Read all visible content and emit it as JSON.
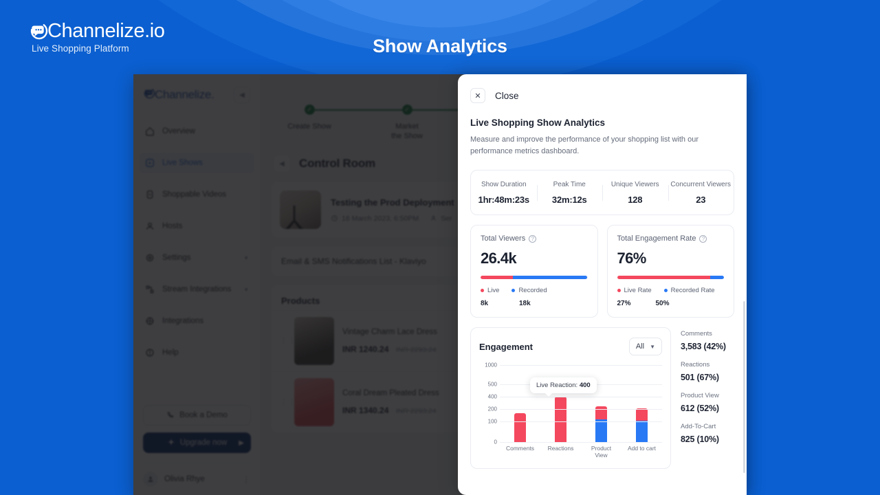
{
  "brand": {
    "name": "Channelize.io",
    "tagline": "Live Shopping Platform",
    "icon": "chat-bubble-icon"
  },
  "page_title": "Show Analytics",
  "app": {
    "sidebar": {
      "logo": "Channelize.",
      "collapse_icon": "chevron-left-icon",
      "items": [
        {
          "label": "Overview",
          "icon": "home-icon",
          "active": false,
          "expandable": false
        },
        {
          "label": "Live Shows",
          "icon": "play-circle-icon",
          "active": true,
          "expandable": false
        },
        {
          "label": "Shoppable Videos",
          "icon": "video-icon",
          "active": false,
          "expandable": false
        },
        {
          "label": "Hosts",
          "icon": "user-icon",
          "active": false,
          "expandable": false
        },
        {
          "label": "Settings",
          "icon": "gear-icon",
          "active": false,
          "expandable": true
        },
        {
          "label": "Stream Integrations",
          "icon": "stream-icon",
          "active": false,
          "expandable": true
        },
        {
          "label": "Integrations",
          "icon": "plug-icon",
          "active": false,
          "expandable": false
        },
        {
          "label": "Help",
          "icon": "help-icon",
          "active": false,
          "expandable": false
        }
      ],
      "demo_button": "Book a Demo",
      "demo_icon": "phone-icon",
      "upgrade_button": "Upgrade now",
      "upgrade_icon": "diamond-icon",
      "upgrade_arrow": "chevron-right-icon",
      "user_name": "Olivia Rhye",
      "user_menu_icon": "more-vertical-icon"
    },
    "stepper": [
      {
        "label": "Create Show",
        "done": true
      },
      {
        "label": "Market\nthe Show",
        "done": true
      }
    ],
    "control_room": {
      "back_icon": "chevron-left-icon",
      "title": "Control Room"
    },
    "show": {
      "title": "Testing the Prod Deployment",
      "date_icon": "clock-icon",
      "date": "18 March 2023, 6:50PM",
      "host_icon": "user-icon",
      "host": "Ser"
    },
    "notifications_row": "Email & SMS Notifications List - Klaviyo",
    "products": {
      "heading": "Products",
      "items": [
        {
          "name": "Vintage Charm Lace Dress",
          "price": "INR 1240.24",
          "compare_at": "INR 2293.24"
        },
        {
          "name": "Coral Dream Pleated Dress",
          "price": "INR 1340.24",
          "compare_at": "INR 2293.24"
        }
      ]
    }
  },
  "modal": {
    "close_icon": "close-icon",
    "close_label": "Close",
    "title": "Live Shopping Show Analytics",
    "subtitle": "Measure and improve the performance of your shopping list with our performance metrics dashboard.",
    "summary": [
      {
        "key": "Show Duration",
        "value": "1hr:48m:23s"
      },
      {
        "key": "Peak Time",
        "value": "32m:12s"
      },
      {
        "key": "Unique Viewers",
        "value": "128"
      },
      {
        "key": "Concurrent Viewers",
        "value": "23"
      }
    ],
    "total_viewers": {
      "label": "Total Viewers",
      "help_icon": "question-circle-icon",
      "value": "26.4k",
      "live_pct": 30,
      "legend": [
        {
          "label": "Live",
          "value": "8k",
          "color": "#F4485E"
        },
        {
          "label": "Recorded",
          "value": "18k",
          "color": "#2979F5"
        }
      ]
    },
    "engagement_rate": {
      "label": "Total Engagement Rate",
      "help_icon": "question-circle-icon",
      "value": "76%",
      "live_pct": 87,
      "legend": [
        {
          "label": "Live Rate",
          "value": "27%",
          "color": "#F4485E"
        },
        {
          "label": "Recorded Rate",
          "value": "50%",
          "color": "#2979F5"
        }
      ]
    },
    "engagement": {
      "title": "Engagement",
      "filter_value": "All",
      "filter_icon": "chevron-down-icon",
      "tooltip": {
        "label": "Live Reaction:",
        "value": "400"
      },
      "stats": [
        {
          "key": "Comments",
          "value": "3,583 (42%)"
        },
        {
          "key": "Reactions",
          "value": "501 (67%)"
        },
        {
          "key": "Product View",
          "value": "612 (52%)"
        },
        {
          "key": "Add-To-Cart",
          "value": "825 (10%)"
        }
      ]
    }
  },
  "chart_data": {
    "type": "bar",
    "title": "Engagement",
    "stacked": true,
    "categories": [
      "Comments",
      "Reactions",
      "Product View",
      "Add to cart"
    ],
    "series": [
      {
        "name": "Live",
        "color": "#F4485E",
        "values": [
          165,
          400,
          95,
          80
        ]
      },
      {
        "name": "Recorded",
        "color": "#2979F5",
        "values": [
          0,
          0,
          155,
          135
        ]
      }
    ],
    "ytick_labels": [
      "1000",
      "500",
      "400",
      "200",
      "100",
      "0"
    ],
    "ytick_positions": [
      0,
      28,
      46,
      64,
      82,
      112
    ],
    "ylim": [
      0,
      1000
    ],
    "grid": true,
    "legend_position": "none",
    "annotations": [
      {
        "text": "Live Reaction: 400",
        "target": "Reactions"
      }
    ],
    "xlabel": "",
    "ylabel": ""
  },
  "colors": {
    "background_blue": "#0B5FD0",
    "accent_red": "#F4485E",
    "accent_blue": "#2979F5",
    "upgrade_navy": "#0A2C6B",
    "step_green": "#127A3E"
  }
}
